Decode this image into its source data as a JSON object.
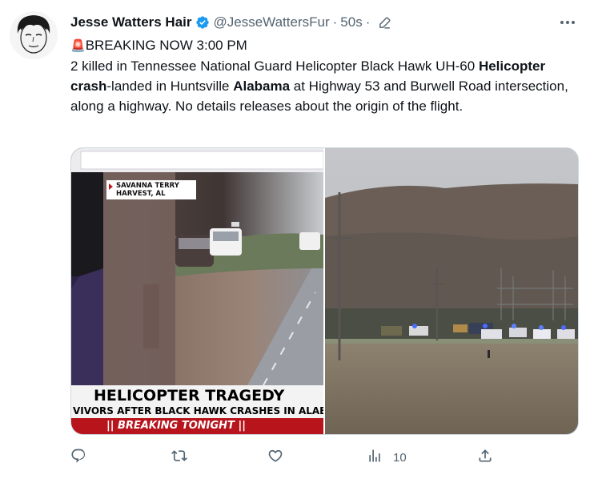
{
  "author": {
    "name": "Jesse Watters Hair",
    "handle": "@JesseWattersFur",
    "time": "50s",
    "separator": "·"
  },
  "tweet": {
    "line1_emoji": "🚨",
    "line1_text": "BREAKING NOW 3:00 PM",
    "body_part1": "2 killed in Tennessee National Guard Helicopter Black Hawk UH-60 ",
    "body_bold1": "Helicopter crash",
    "body_part2": "-landed in Huntsville ",
    "body_bold2": "Alabama",
    "body_part3": " at Highway 53 and Burwell Road intersection, along a highway.  No details releases about the origin of the flight."
  },
  "media_left": {
    "location_line1": "SAVANNA TERRY",
    "location_line2": "HARVEST, AL",
    "headline": "HELICOPTER TRAGEDY",
    "subline": "VIVORS AFTER BLACK HAWK CRASHES IN ALABA",
    "ticker": "BREAKING TONIGHT"
  },
  "actions": {
    "reply_count": "",
    "retweet_count": "",
    "like_count": "",
    "views_count": "10"
  },
  "colors": {
    "verified_blue": "#1d9bf0",
    "muted_text": "#536471",
    "fox_red": "#b8141c"
  }
}
